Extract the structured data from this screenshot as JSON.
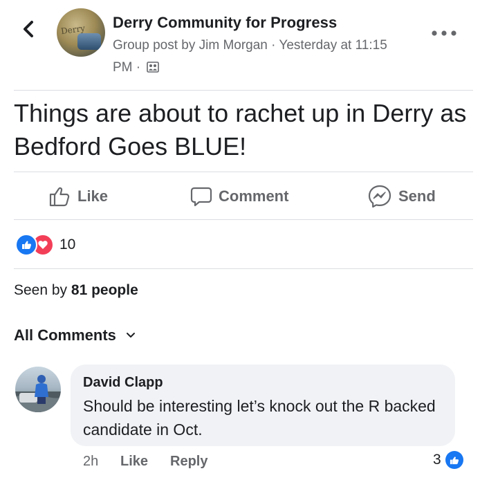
{
  "header": {
    "group_name": "Derry Community for Progress",
    "meta_line": "Group post by Jim Morgan · Yesterday at 11:15 PM ·",
    "avatar_text": "Derry"
  },
  "post": {
    "text": "Things are about to rachet up in Derry as Bedford Goes BLUE!"
  },
  "actions": {
    "like_label": "Like",
    "comment_label": "Comment",
    "send_label": "Send"
  },
  "reactions": {
    "count": "10",
    "types": [
      "like",
      "love"
    ]
  },
  "seen": {
    "prefix": "Seen by ",
    "count_text": "81 people"
  },
  "comments_filter": {
    "label": "All Comments"
  },
  "comments": [
    {
      "author": "David Clapp",
      "text": "Should be interesting let’s knock out the R backed candidate in Oct.",
      "time": "2h",
      "like_label": "Like",
      "reply_label": "Reply",
      "reaction_count": "3"
    }
  ],
  "colors": {
    "like_blue": "#1877f2",
    "love_red": "#f33e58",
    "secondary_text": "#65676b",
    "bubble_bg": "#f0f2f5",
    "divider": "#dadde1"
  },
  "icons": {
    "back": "back-chevron-icon",
    "more": "more-dots-icon",
    "privacy": "group-privacy-icon",
    "like": "thumbs-up-icon",
    "comment": "comment-bubble-icon",
    "send": "messenger-icon",
    "dropdown": "chevron-down-icon"
  }
}
